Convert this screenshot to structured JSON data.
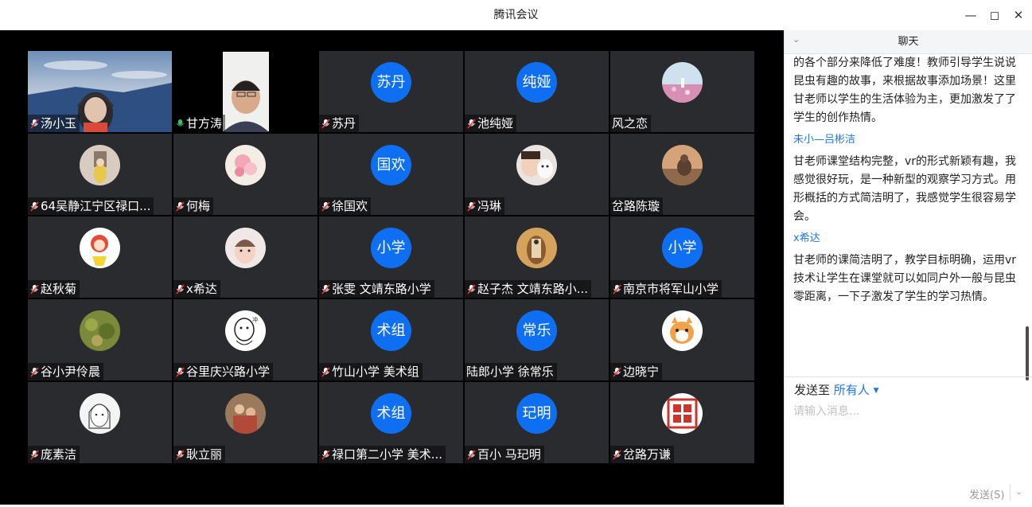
{
  "window": {
    "title": "腾讯会议",
    "minimize_icon": "minimize-icon",
    "maximize_icon": "maximize-icon",
    "close_icon": "close-icon"
  },
  "participants": [
    {
      "name": "汤小玉",
      "mic": "muted",
      "avatar": "photo-girl-headset"
    },
    {
      "name": "甘方涛",
      "mic": "active",
      "avatar": "photo-man-video",
      "active": true
    },
    {
      "name": "苏丹",
      "mic": "muted",
      "avatar_text": "苏丹"
    },
    {
      "name": "池纯娅",
      "mic": "muted",
      "avatar_text": "纯娅"
    },
    {
      "name": "风之恋",
      "mic": "none",
      "avatar": "photo-flower-field"
    },
    {
      "name": "64吴静江宁区禄口...",
      "mic": "muted",
      "avatar": "photo-child-room"
    },
    {
      "name": "何梅",
      "mic": "muted",
      "avatar": "photo-pink-flower"
    },
    {
      "name": "徐国欢",
      "mic": "muted",
      "avatar_text": "国欢"
    },
    {
      "name": "冯琳",
      "mic": "muted",
      "avatar": "photo-girl-toy"
    },
    {
      "name": "岔路陈璇",
      "mic": "none",
      "avatar": "photo-cat-wall"
    },
    {
      "name": "赵秋菊",
      "mic": "muted",
      "avatar": "cartoon-girl"
    },
    {
      "name": "x希达",
      "mic": "muted",
      "avatar": "photo-child-face"
    },
    {
      "name": "张雯 文靖东路小学",
      "mic": "muted",
      "avatar_text": "小学"
    },
    {
      "name": "赵子杰 文靖东路小...",
      "mic": "muted",
      "avatar": "photo-horse"
    },
    {
      "name": "南京市将军山小学",
      "mic": "muted",
      "avatar_text": "小学"
    },
    {
      "name": "谷小尹伶晨",
      "mic": "muted",
      "avatar": "photo-green-field"
    },
    {
      "name": "谷里庆兴路小学",
      "mic": "muted",
      "avatar": "sketch-character"
    },
    {
      "name": "竹山小学 美术组",
      "mic": "muted",
      "avatar_text": "术组"
    },
    {
      "name": "陆郎小学 徐常乐",
      "mic": "none",
      "avatar_text": "常乐"
    },
    {
      "name": "边晓宁",
      "mic": "muted",
      "avatar": "cartoon-cat"
    },
    {
      "name": "庞素洁",
      "mic": "muted",
      "avatar": "sketch-girl"
    },
    {
      "name": "耿立丽",
      "mic": "muted",
      "avatar": "photo-people"
    },
    {
      "name": "禄口第二小学 美术...",
      "mic": "muted",
      "avatar_text": "术组"
    },
    {
      "name": "百小 马玘明",
      "mic": "muted",
      "avatar_text": "玘明"
    },
    {
      "name": "岔路万谦",
      "mic": "muted",
      "avatar": "red-seal"
    }
  ],
  "chat": {
    "header": "聊天",
    "collapse_icon": "chevron-down-icon",
    "messages": [
      {
        "sender": "",
        "text": "的各个部分来降低了难度！教师引导学生说说昆虫有趣的故事，来根据故事添加场景！这里甘老师以学生的生活体验为主，更加激发了了学生的创作热情。"
      },
      {
        "sender": "未小—吕彬洁",
        "text": "甘老师课堂结构完整，vr的形式新颖有趣，我感觉很好玩，是一种新型的观察学习方式。用形概括的方式简洁明了，我感觉学生很容易学会。"
      },
      {
        "sender": "x希达",
        "text": "甘老师的课简洁明了，教学目标明确，运用vr技术让学生在课堂就可以如同户外一般与昆虫零距离，一下子激发了学生的学习热情。"
      }
    ],
    "send_to_label": "发送至",
    "recipient": "所有人",
    "input_placeholder": "请输入消息...",
    "send_button": "发送(S)"
  },
  "colors": {
    "avatar_blue": "#0e6ff2",
    "link_blue": "#1f78e0",
    "active_border": "#2fb563",
    "tile_bg": "#2a2b2f"
  }
}
